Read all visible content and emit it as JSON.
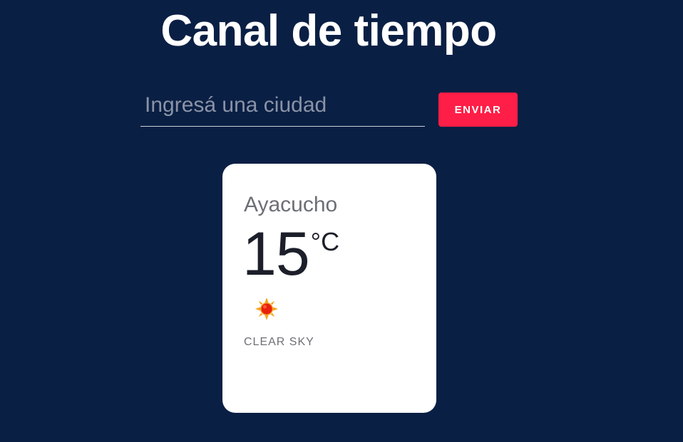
{
  "header": {
    "title": "Canal de tiempo"
  },
  "search": {
    "placeholder": "Ingresá una ciudad",
    "value": "",
    "submit_label": "ENVIAR"
  },
  "weather": {
    "city": "Ayacucho",
    "temperature": "15",
    "unit": "°C",
    "icon": "sun-icon",
    "condition": "CLEAR SKY"
  },
  "colors": {
    "background": "#0a1f44",
    "accent": "#ff1e47",
    "card": "#ffffff"
  }
}
